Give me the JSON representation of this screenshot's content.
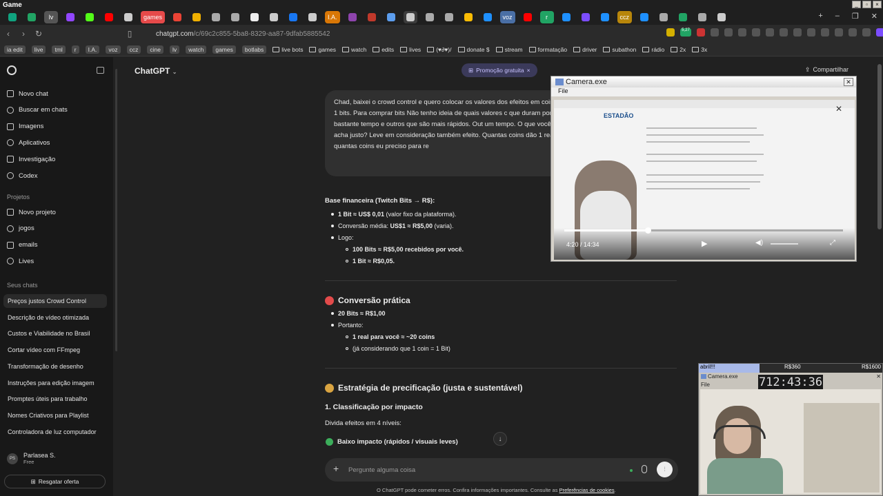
{
  "window": {
    "title": "Game"
  },
  "tabs": [
    {
      "label": "",
      "icon": "chatgpt-icon",
      "color": "#10a37f"
    },
    {
      "label": "",
      "icon": "sheets-icon",
      "color": "#21a464"
    },
    {
      "label": "lv",
      "icon": "",
      "color": "#555"
    },
    {
      "label": "",
      "icon": "twitch-icon",
      "color": "#9146ff"
    },
    {
      "label": "",
      "icon": "kick-icon",
      "color": "#53fc18"
    },
    {
      "label": "",
      "icon": "youtube-icon",
      "color": "#ff0000"
    },
    {
      "label": "",
      "icon": "download-icon",
      "color": "#ccc"
    },
    {
      "label": "games",
      "icon": "",
      "color": "#e64a4a"
    },
    {
      "label": "",
      "icon": "gmail-icon",
      "color": "#ea4335"
    },
    {
      "label": "",
      "icon": "warning-icon",
      "color": "#f0b000"
    },
    {
      "label": "",
      "icon": "circle-icon",
      "color": "#aaa"
    },
    {
      "label": "",
      "icon": "circle-icon",
      "color": "#aaa"
    },
    {
      "label": "",
      "icon": "notion-icon",
      "color": "#eee"
    },
    {
      "label": "",
      "icon": "gear-icon",
      "color": "#ccc"
    },
    {
      "label": "",
      "icon": "s-icon",
      "color": "#1877f2"
    },
    {
      "label": "",
      "icon": "download-icon",
      "color": "#ccc"
    },
    {
      "label": "I.A.",
      "icon": "",
      "color": "#d97706"
    },
    {
      "label": "",
      "icon": "circle-icon",
      "color": "#8e44ad"
    },
    {
      "label": "",
      "icon": "circle-icon",
      "color": "#c0392b"
    },
    {
      "label": "",
      "icon": "window-icon",
      "color": "#5c9ded"
    },
    {
      "label": "",
      "icon": "close-icon",
      "color": "#ccc"
    },
    {
      "label": "",
      "icon": "circle-icon",
      "color": "#aaa"
    },
    {
      "label": "",
      "icon": "circle-icon",
      "color": "#aaa"
    },
    {
      "label": "",
      "icon": "drive-icon",
      "color": "#fbbc04"
    },
    {
      "label": "",
      "icon": "circle-icon",
      "color": "#1e90ff"
    },
    {
      "label": "voz",
      "icon": "",
      "color": "#4a6fa5"
    },
    {
      "label": "",
      "icon": "youtube-icon",
      "color": "#ff0000"
    },
    {
      "label": "r",
      "icon": "",
      "color": "#21a464"
    },
    {
      "label": "",
      "icon": "globe-icon",
      "color": "#1e90ff"
    },
    {
      "label": "",
      "icon": "doc-icon",
      "color": "#7c4dff"
    },
    {
      "label": "",
      "icon": "circle-icon",
      "color": "#1e90ff"
    },
    {
      "label": "ccz",
      "icon": "",
      "color": "#b8860b"
    },
    {
      "label": "",
      "icon": "circle-icon",
      "color": "#1e90ff"
    },
    {
      "label": "",
      "icon": "circle-icon",
      "color": "#aaa"
    },
    {
      "label": "",
      "icon": "circle-icon",
      "color": "#21a464"
    },
    {
      "label": "",
      "icon": "circle-icon",
      "color": "#aaa"
    },
    {
      "label": "",
      "icon": "chrome-icon",
      "color": "#ccc"
    }
  ],
  "address_bar": {
    "url_host": "chatgpt.com",
    "url_path": "/c/69c2c855-5ba8-8329-aa87-9dfab5885542",
    "counter": "5,27"
  },
  "bookmarks": [
    {
      "label": "ia edit",
      "chip": true
    },
    {
      "label": "live",
      "chip": true
    },
    {
      "label": "tml",
      "chip": true
    },
    {
      "label": "r",
      "chip": true
    },
    {
      "label": "I.A.",
      "chip": true
    },
    {
      "label": "voz",
      "chip": true
    },
    {
      "label": "ccz",
      "chip": true
    },
    {
      "label": "cine",
      "chip": true
    },
    {
      "label": "lv",
      "chip": true
    },
    {
      "label": "watch",
      "chip": true
    },
    {
      "label": "games",
      "chip": true
    },
    {
      "label": "botlabs",
      "chip": true
    },
    {
      "label": "live bots",
      "chip": false
    },
    {
      "label": "games",
      "chip": false
    },
    {
      "label": "watch",
      "chip": false
    },
    {
      "label": "edits",
      "chip": false
    },
    {
      "label": "lives",
      "chip": false
    },
    {
      "label": "(♥∂♥)/",
      "chip": false
    },
    {
      "label": "donate $",
      "chip": false
    },
    {
      "label": "stream",
      "chip": false
    },
    {
      "label": "formatação",
      "chip": false
    },
    {
      "label": "driver",
      "chip": false
    },
    {
      "label": "subathon",
      "chip": false
    },
    {
      "label": "rádio",
      "chip": false
    },
    {
      "label": "2x",
      "chip": false
    },
    {
      "label": "3x",
      "chip": false
    }
  ],
  "sidebar": {
    "nav": [
      {
        "label": "Novo chat",
        "icon": "edit-icon"
      },
      {
        "label": "Buscar em chats",
        "icon": "search-icon"
      },
      {
        "label": "Imagens",
        "icon": "image-icon"
      },
      {
        "label": "Aplicativos",
        "icon": "apps-icon"
      },
      {
        "label": "Investigação",
        "icon": "research-icon"
      },
      {
        "label": "Codex",
        "icon": "code-icon"
      }
    ],
    "projects_heading": "Projetos",
    "projects": [
      {
        "label": "Novo projeto",
        "icon": "folder-plus-icon"
      },
      {
        "label": "jogos",
        "icon": "folder-icon"
      },
      {
        "label": "emails",
        "icon": "folder-icon"
      },
      {
        "label": "Lives",
        "icon": "folder-icon"
      }
    ],
    "chats_heading": "Seus chats",
    "chats": [
      "Preços justos Crowd Control",
      "Descrição de vídeo otimizada",
      "Custos e Viabilidade no Brasil",
      "Cortar vídeo com FFmpeg",
      "Transformação de desenho",
      "Instruções para edição imagem",
      "Promptes úteis para trabalho",
      "Nomes Criativos para Playlist",
      "Controladora de luz computador"
    ],
    "user": {
      "initials": "PS",
      "name": "Parlasea S.",
      "plan": "Free"
    },
    "offer_label": "Resgatar oferta"
  },
  "header": {
    "model": "ChatGPT",
    "promo": "Promoção gratuita",
    "share": "Compartilhar"
  },
  "user_message": {
    "text": "Chad, baixei o crowd control e quero colocar os valores dos efeitos em coins = 1 bits. Para comprar bits Não tenho ideia de quais valores c que duram por bastante tempo e outros que são mais rápidos. Out um tempo. O que você acha justo? Leve em consideração também efeito. Quantas coins dão 1 real e quantas coins eu preciso para re"
  },
  "response": {
    "base_heading": "Base financeira (Twitch Bits → R$):",
    "base_items": [
      {
        "bold": "1 Bit ≈ US$ 0,01",
        "rest": " (valor fixo da plataforma)."
      },
      {
        "bold": "",
        "rest": "Conversão média: ",
        "bold2": "US$1 ≈ R$5,00",
        "rest2": " (varia)."
      },
      {
        "bold": "",
        "rest": "Logo:"
      }
    ],
    "base_sub": [
      "100 Bits ≈ R$5,00 recebidos por você.",
      "1 Bit ≈ R$0,05."
    ],
    "conv_heading": "Conversão prática",
    "conv_items": [
      "20 Bits ≈ R$1,00",
      "Portanto:"
    ],
    "conv_sub": [
      "1 real para você ≈ ~20 coins",
      "(já considerando que 1 coin = 1 Bit)"
    ],
    "strategy_heading": "Estratégia de precificação (justa e sustentável)",
    "step1": "1. Classificação por impacto",
    "step1_desc": "Divida efeitos em 4 níveis:",
    "level1": "Baixo impacto (rápidos / visuais leves)"
  },
  "composer": {
    "placeholder": "Pergunte alguma coisa"
  },
  "footer": {
    "text": "O ChatGPT pode cometer erros. Confira informações importantes. Consulte as ",
    "link": "Preferências de cookies",
    "end": "."
  },
  "camera_window": {
    "title": "Camera.exe",
    "menu": "File",
    "video_time": "4:20 / 14:34",
    "video_progress": 0.3,
    "news_brand": "ESTADÃO"
  },
  "stream_overlay": {
    "label_left": "abril!!!",
    "label_mid": "R$360",
    "label_right": "R$1600",
    "timer": "712:43:36",
    "cam_title": "Camera.exe",
    "cam_menu": "File"
  }
}
